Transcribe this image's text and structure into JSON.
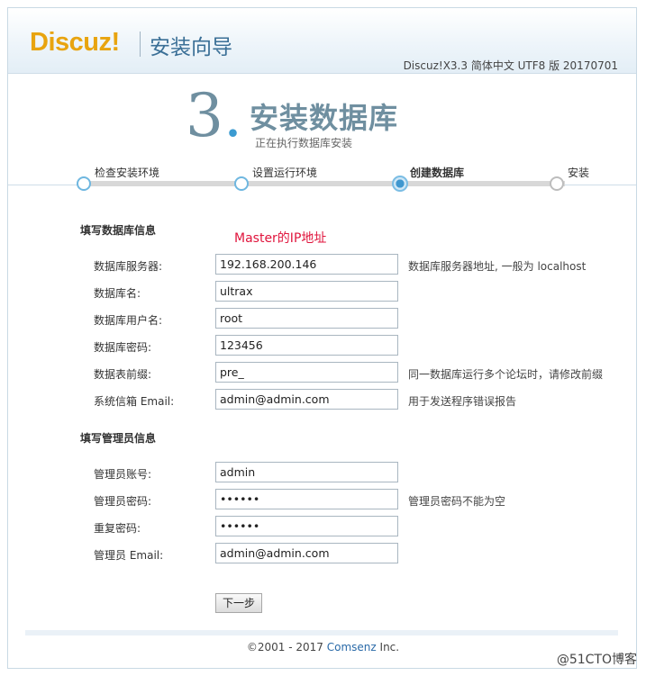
{
  "header": {
    "logo_text": "Discuz",
    "logo_excl": "!",
    "title": "安装向导",
    "version": "Discuz!X3.3 简体中文 UTF8 版 20170701"
  },
  "step": {
    "number": "3",
    "dot": ".",
    "title": "安装数据库",
    "subtitle": "正在执行数据库安装"
  },
  "progress": {
    "steps": [
      {
        "label": "检查安装环境",
        "state": "done"
      },
      {
        "label": "设置运行环境",
        "state": "done"
      },
      {
        "label": "创建数据库",
        "state": "current"
      },
      {
        "label": "安装",
        "state": "pending"
      }
    ]
  },
  "db_section": {
    "title": "填写数据库信息",
    "annotation": "Master的IP地址",
    "rows": [
      {
        "label": "数据库服务器:",
        "value": "192.168.200.146",
        "hint": "数据库服务器地址, 一般为 localhost"
      },
      {
        "label": "数据库名:",
        "value": "ultrax",
        "hint": ""
      },
      {
        "label": "数据库用户名:",
        "value": "root",
        "hint": ""
      },
      {
        "label": "数据库密码:",
        "value": "123456",
        "hint": ""
      },
      {
        "label": "数据表前缀:",
        "value": "pre_",
        "hint": "同一数据库运行多个论坛时，请修改前缀"
      },
      {
        "label": "系统信箱 Email:",
        "value": "admin@admin.com",
        "hint": "用于发送程序错误报告"
      }
    ]
  },
  "admin_section": {
    "title": "填写管理员信息",
    "rows": [
      {
        "label": "管理员账号:",
        "value": "admin",
        "hint": ""
      },
      {
        "label": "管理员密码:",
        "value": "••••••",
        "hint": "管理员密码不能为空"
      },
      {
        "label": "重复密码:",
        "value": "••••••",
        "hint": ""
      },
      {
        "label": "管理员 Email:",
        "value": "admin@admin.com",
        "hint": ""
      }
    ]
  },
  "submit_label": "下一步",
  "footer": {
    "copyright": "©2001 - 2017 ",
    "company": "Comsenz",
    "suffix": " Inc."
  },
  "watermark": "@51CTO博客"
}
